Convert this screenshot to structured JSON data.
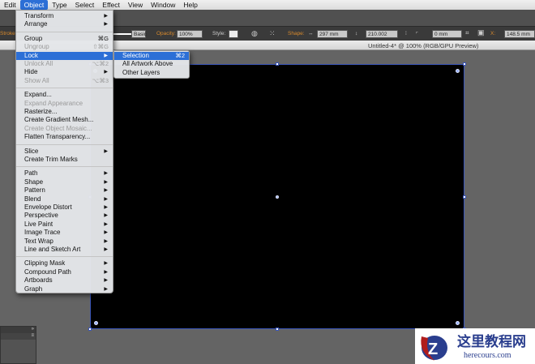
{
  "menubar": {
    "items": [
      "Edit",
      "Object",
      "Type",
      "Select",
      "Effect",
      "View",
      "Window",
      "Help"
    ],
    "active": "Object"
  },
  "control_bar": {
    "stroke_label": "Stroke:",
    "brush": "Basic",
    "opacity_label": "Opacity:",
    "opacity": "100%",
    "style_label": "Style:",
    "shape_label": "Shape:",
    "width": "297 mm",
    "height": "210.002 mm",
    "corner": "0 mm",
    "x_label": "X:",
    "x": "148.5 mm"
  },
  "document_title": "Untitled-4* @ 100% (RGB/GPU Preview)",
  "object_menu": [
    {
      "label": "Transform",
      "submenu": true
    },
    {
      "label": "Arrange",
      "submenu": true
    },
    {
      "sep": true
    },
    {
      "label": "Group",
      "shortcut": "⌘G"
    },
    {
      "label": "Ungroup",
      "shortcut": "⇧⌘G",
      "disabled": true
    },
    {
      "label": "Lock",
      "submenu": true,
      "highlighted": true
    },
    {
      "label": "Unlock All",
      "shortcut": "⌥⌘2",
      "disabled": true
    },
    {
      "label": "Hide",
      "submenu": true
    },
    {
      "label": "Show All",
      "shortcut": "⌥⌘3",
      "disabled": true
    },
    {
      "sep": true
    },
    {
      "label": "Expand..."
    },
    {
      "label": "Expand Appearance",
      "disabled": true
    },
    {
      "label": "Rasterize..."
    },
    {
      "label": "Create Gradient Mesh..."
    },
    {
      "label": "Create Object Mosaic...",
      "disabled": true
    },
    {
      "label": "Flatten Transparency..."
    },
    {
      "sep": true
    },
    {
      "label": "Slice",
      "submenu": true
    },
    {
      "label": "Create Trim Marks"
    },
    {
      "sep": true
    },
    {
      "label": "Path",
      "submenu": true
    },
    {
      "label": "Shape",
      "submenu": true
    },
    {
      "label": "Pattern",
      "submenu": true
    },
    {
      "label": "Blend",
      "submenu": true
    },
    {
      "label": "Envelope Distort",
      "submenu": true
    },
    {
      "label": "Perspective",
      "submenu": true
    },
    {
      "label": "Live Paint",
      "submenu": true
    },
    {
      "label": "Image Trace",
      "submenu": true
    },
    {
      "label": "Text Wrap",
      "submenu": true
    },
    {
      "label": "Line and Sketch Art",
      "submenu": true
    },
    {
      "sep": true
    },
    {
      "label": "Clipping Mask",
      "submenu": true
    },
    {
      "label": "Compound Path",
      "submenu": true
    },
    {
      "label": "Artboards",
      "submenu": true
    },
    {
      "label": "Graph",
      "submenu": true
    }
  ],
  "lock_submenu": [
    {
      "label": "Selection",
      "shortcut": "⌘2",
      "highlighted": true
    },
    {
      "label": "All Artwork Above"
    },
    {
      "label": "Other Layers"
    }
  ],
  "watermark": {
    "title": "这里教程网",
    "url": "herecours.com"
  }
}
